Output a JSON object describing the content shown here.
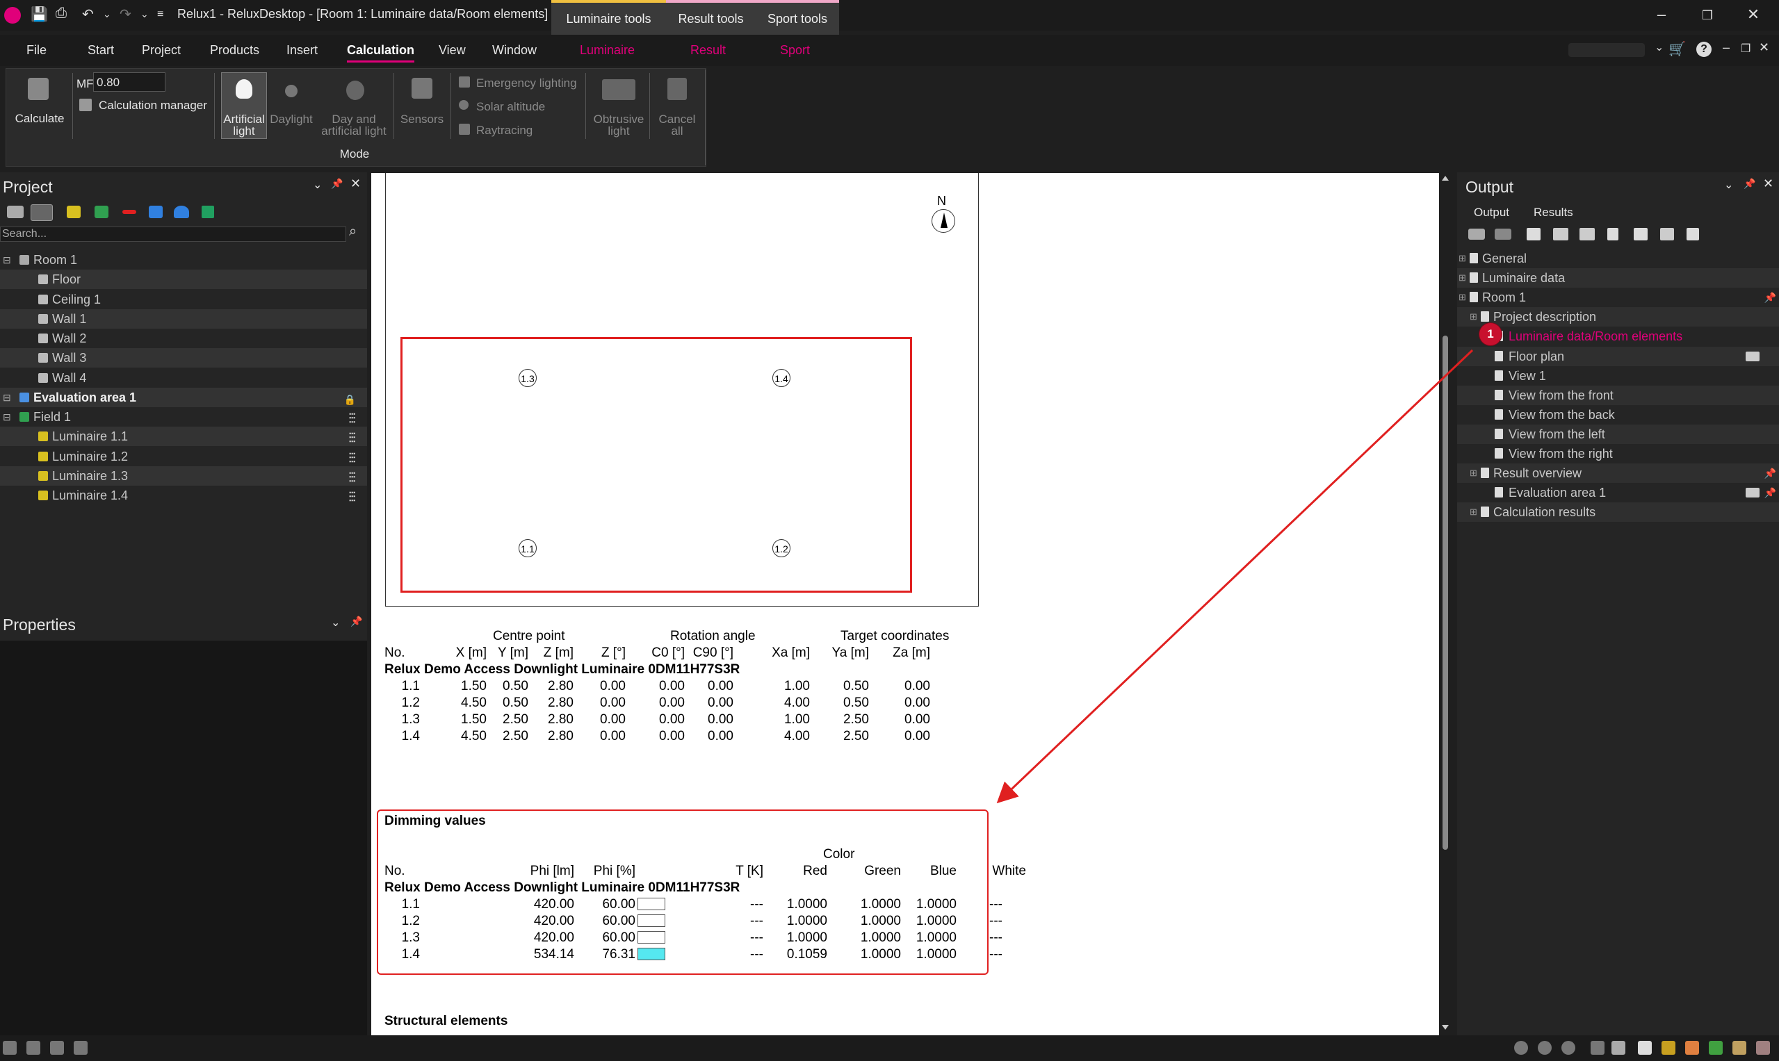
{
  "window": {
    "title": "Relux1 - ReluxDesktop - [Room 1: Luminaire data/Room elements]",
    "context_tabs": [
      "Luminaire tools",
      "Result tools",
      "Sport tools"
    ]
  },
  "menu": [
    "File",
    "Start",
    "Project",
    "Products",
    "Insert",
    "Calculation",
    "View",
    "Window",
    "Luminaire",
    "Result",
    "Sport"
  ],
  "ribbon": {
    "calculate": "Calculate",
    "mf_label": "MF",
    "mf_value": "0.80",
    "calc_manager": "Calculation manager",
    "artificial": [
      "Artificial",
      "light"
    ],
    "daylight": "Daylight",
    "day_artificial": [
      "Day and",
      "artificial light"
    ],
    "sensors": "Sensors",
    "emergency": "Emergency lighting",
    "solar": "Solar altitude",
    "raytracing": "Raytracing",
    "obtrusive": [
      "Obtrusive",
      "light"
    ],
    "cancel": [
      "Cancel",
      "all"
    ],
    "group_label": "Mode"
  },
  "project": {
    "title": "Project",
    "search_placeholder": "Search...",
    "tree": [
      {
        "label": "Room 1",
        "indent": 0
      },
      {
        "label": "Floor",
        "indent": 1
      },
      {
        "label": "Ceiling 1",
        "indent": 1
      },
      {
        "label": "Wall 1",
        "indent": 1
      },
      {
        "label": "Wall 2",
        "indent": 1
      },
      {
        "label": "Wall 3",
        "indent": 1
      },
      {
        "label": "Wall 4",
        "indent": 1
      },
      {
        "label": "Evaluation area 1",
        "indent": 0,
        "bold": true
      },
      {
        "label": "Field 1",
        "indent": 0
      },
      {
        "label": "Luminaire  1.1",
        "indent": 1
      },
      {
        "label": "Luminaire  1.2",
        "indent": 1
      },
      {
        "label": "Luminaire  1.3",
        "indent": 1
      },
      {
        "label": "Luminaire  1.4",
        "indent": 1
      }
    ]
  },
  "properties": {
    "title": "Properties"
  },
  "document": {
    "north": "N",
    "plan_labels": [
      "1.3",
      "1.4",
      "1.1",
      "1.2"
    ],
    "positions_table": {
      "group_headers": [
        "Centre point",
        "Rotation angle",
        "Target coordinates"
      ],
      "columns": [
        "No.",
        "X [m]",
        "Y [m]",
        "Z [m]",
        "Z [°]",
        "C0 [°]",
        "C90 [°]",
        "Xa [m]",
        "Ya [m]",
        "Za [m]"
      ],
      "product": "Relux Demo Access Downlight Luminaire 0DM11H77S3R",
      "rows": [
        [
          "1.1",
          "1.50",
          "0.50",
          "2.80",
          "0.00",
          "0.00",
          "0.00",
          "1.00",
          "0.50",
          "0.00"
        ],
        [
          "1.2",
          "4.50",
          "0.50",
          "2.80",
          "0.00",
          "0.00",
          "0.00",
          "4.00",
          "0.50",
          "0.00"
        ],
        [
          "1.3",
          "1.50",
          "2.50",
          "2.80",
          "0.00",
          "0.00",
          "0.00",
          "1.00",
          "2.50",
          "0.00"
        ],
        [
          "1.4",
          "4.50",
          "2.50",
          "2.80",
          "0.00",
          "0.00",
          "0.00",
          "4.00",
          "2.50",
          "0.00"
        ]
      ]
    },
    "dimming": {
      "title": "Dimming values",
      "color_header": "Color",
      "columns": [
        "No.",
        "Phi [lm]",
        "Phi [%]",
        "T [K]",
        "Red",
        "Green",
        "Blue",
        "White"
      ],
      "product": "Relux Demo Access Downlight Luminaire 0DM11H77S3R",
      "rows": [
        {
          "no": "1.1",
          "phi_lm": "420.00",
          "phi_pct": "60.00",
          "swatch": "#ffffff",
          "t": "---",
          "red": "1.0000",
          "green": "1.0000",
          "blue": "1.0000",
          "white": "---"
        },
        {
          "no": "1.2",
          "phi_lm": "420.00",
          "phi_pct": "60.00",
          "swatch": "#ffffff",
          "t": "---",
          "red": "1.0000",
          "green": "1.0000",
          "blue": "1.0000",
          "white": "---"
        },
        {
          "no": "1.3",
          "phi_lm": "420.00",
          "phi_pct": "60.00",
          "swatch": "#ffffff",
          "t": "---",
          "red": "1.0000",
          "green": "1.0000",
          "blue": "1.0000",
          "white": "---"
        },
        {
          "no": "1.4",
          "phi_lm": "534.14",
          "phi_pct": "76.31",
          "swatch": "#55e8f0",
          "t": "---",
          "red": "0.1059",
          "green": "1.0000",
          "blue": "1.0000",
          "white": "---"
        }
      ]
    },
    "structural": "Structural elements"
  },
  "output": {
    "title": "Output",
    "tabs": [
      "Output",
      "Results"
    ],
    "tree": [
      {
        "label": "General",
        "indent": 0
      },
      {
        "label": "Luminaire data",
        "indent": 0
      },
      {
        "label": "Room 1",
        "indent": 0
      },
      {
        "label": "Project description",
        "indent": 1
      },
      {
        "label": "Luminaire data/Room elements",
        "indent": 2,
        "active": true
      },
      {
        "label": "Floor plan",
        "indent": 2
      },
      {
        "label": "View 1",
        "indent": 2
      },
      {
        "label": "View from the front",
        "indent": 2
      },
      {
        "label": "View from the back",
        "indent": 2
      },
      {
        "label": "View from the left",
        "indent": 2
      },
      {
        "label": "View from the right",
        "indent": 2
      },
      {
        "label": "Result overview",
        "indent": 1
      },
      {
        "label": "Evaluation area 1",
        "indent": 2
      },
      {
        "label": "Calculation results",
        "indent": 1
      }
    ],
    "badge": "1"
  },
  "colors": {
    "accent": "#e0007a",
    "highlight_red": "#e02020"
  }
}
